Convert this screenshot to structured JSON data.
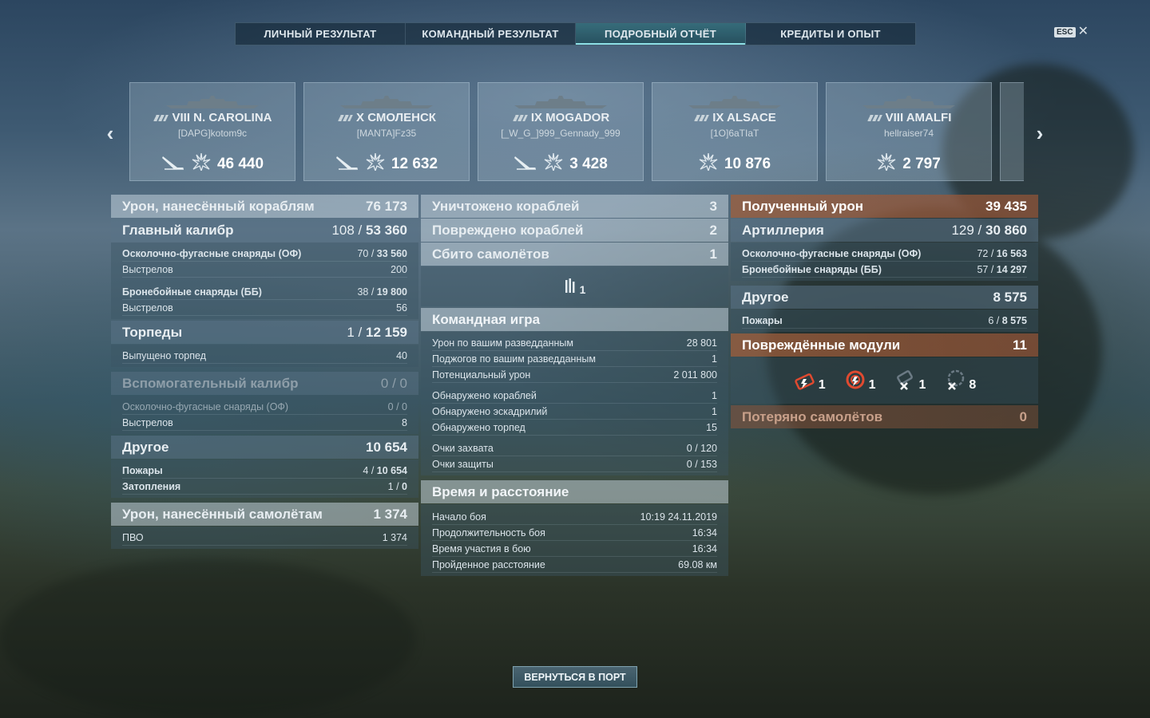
{
  "tabs": [
    "ЛИЧНЫЙ РЕЗУЛЬТАТ",
    "КОМАНДНЫЙ РЕЗУЛЬТАТ",
    "ПОДРОБНЫЙ ОТЧЁТ",
    "КРЕДИТЫ И ОПЫТ"
  ],
  "active_tab": "ПОДРОБНЫЙ ОТЧЁТ",
  "esc_label": "ESC",
  "ships": [
    {
      "name": "VIII N. CAROLINA",
      "player": "[DAPG]kotom9c",
      "damage": "46 440",
      "sunk_icon": true
    },
    {
      "name": "X СМОЛЕНСК",
      "player": "[MANTA]Fz35",
      "damage": "12 632",
      "sunk_icon": true
    },
    {
      "name": "IX MOGADOR",
      "player": "[_W_G_]999_Gennady_999",
      "damage": "3 428",
      "sunk_icon": true
    },
    {
      "name": "IX ALSACE",
      "player": "[1O]6aTIaT",
      "damage": "10 876",
      "sunk_icon": false
    },
    {
      "name": "VIII AMALFI",
      "player": "hellraiser74",
      "damage": "2 797",
      "sunk_icon": false
    }
  ],
  "left": {
    "dmg_ships": {
      "label": "Урон, нанесённый кораблям",
      "value": "76 173"
    },
    "main": {
      "label": "Главный калибр",
      "hits": "108",
      "value": "53 360"
    },
    "he": {
      "label": "Осколочно-фугасные снаряды (ОФ)",
      "hits": "70",
      "value": "33 560"
    },
    "he_shots": {
      "label": "Выстрелов",
      "value": "200"
    },
    "ap": {
      "label": "Бронебойные снаряды (ББ)",
      "hits": "38",
      "value": "19 800"
    },
    "ap_shots": {
      "label": "Выстрелов",
      "value": "56"
    },
    "torp": {
      "label": "Торпеды",
      "hits": "1",
      "value": "12 159"
    },
    "torp_launched": {
      "label": "Выпущено торпед",
      "value": "40"
    },
    "sec": {
      "label": "Вспомогательный калибр",
      "hits": "0",
      "value": "0"
    },
    "sec_he": {
      "label": "Осколочно-фугасные снаряды (ОФ)",
      "hits": "0",
      "value": "0"
    },
    "sec_shots": {
      "label": "Выстрелов",
      "value": "8"
    },
    "other": {
      "label": "Другое",
      "value": "10 654"
    },
    "fires": {
      "label": "Пожары",
      "hits": "4",
      "value": "10 654"
    },
    "floods": {
      "label": "Затопления",
      "hits": "1",
      "value": "0"
    },
    "dmg_planes": {
      "label": "Урон, нанесённый самолётам",
      "value": "1 374"
    },
    "aa": {
      "label": "ПВО",
      "value": "1 374"
    }
  },
  "middle": {
    "destroyed": {
      "label": "Уничтожено кораблей",
      "value": "3"
    },
    "damaged": {
      "label": "Повреждено кораблей",
      "value": "2"
    },
    "planes_down": {
      "label": "Сбито самолётов",
      "value": "1"
    },
    "planes_icon_count": "1",
    "team": {
      "label": "Командная игра"
    },
    "spot_dmg": {
      "label": "Урон по вашим разведданным",
      "value": "28 801"
    },
    "spot_fires": {
      "label": "Поджогов по вашим разведданным",
      "value": "1"
    },
    "potential": {
      "label": "Потенциальный урон",
      "value": "2 011 800"
    },
    "spotted_ships": {
      "label": "Обнаружено кораблей",
      "value": "1"
    },
    "spotted_sq": {
      "label": "Обнаружено эскадрилий",
      "value": "1"
    },
    "spotted_torp": {
      "label": "Обнаружено торпед",
      "value": "15"
    },
    "capture": {
      "label": "Очки захвата",
      "value": "0 / 120"
    },
    "defense": {
      "label": "Очки защиты",
      "value": "0 / 153"
    },
    "time": {
      "label": "Время и расстояние"
    },
    "start": {
      "label": "Начало боя",
      "value": "10:19  24.11.2019"
    },
    "duration": {
      "label": "Продолжительность боя",
      "value": "16:34"
    },
    "participation": {
      "label": "Время участия в бою",
      "value": "16:34"
    },
    "distance": {
      "label": "Пройденное расстояние",
      "value": "69.08 км"
    }
  },
  "right": {
    "received": {
      "label": "Полученный урон",
      "value": "39 435"
    },
    "artillery": {
      "label": "Артиллерия",
      "hits": "129",
      "value": "30 860"
    },
    "he": {
      "label": "Осколочно-фугасные снаряды (ОФ)",
      "hits": "72",
      "value": "16 563"
    },
    "ap": {
      "label": "Бронебойные снаряды (ББ)",
      "hits": "57",
      "value": "14 297"
    },
    "other": {
      "label": "Другое",
      "value": "8 575"
    },
    "fires": {
      "label": "Пожары",
      "hits": "6",
      "value": "8 575"
    },
    "modules": {
      "label": "Повреждённые модули",
      "value": "11"
    },
    "module_counts": [
      "1",
      "1",
      "1",
      "8"
    ],
    "planes_lost": {
      "label": "Потеряно самолётов",
      "value": "0"
    }
  },
  "back_button": "ВЕРНУТЬСЯ В ПОРТ",
  "colors": {
    "accent": "#8de0e6",
    "orange": "#a05f3c"
  }
}
